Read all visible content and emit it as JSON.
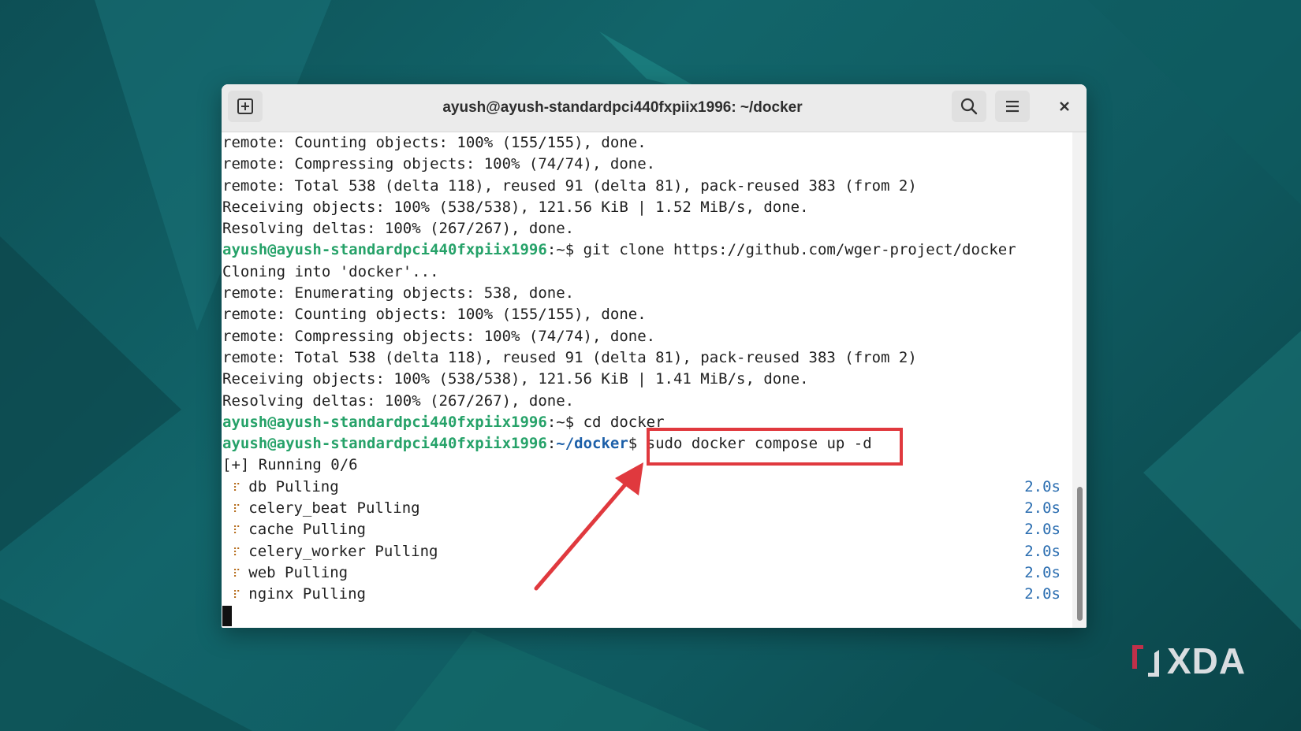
{
  "window": {
    "title": "ayush@ayush-standardpci440fxpiix1996: ~/docker",
    "icons": {
      "new_tab": "new-tab-icon",
      "search": "search-icon",
      "menu": "hamburger-menu-icon",
      "close": "close-icon"
    }
  },
  "terminal": {
    "lines": [
      "remote: Counting objects: 100% (155/155), done.",
      "remote: Compressing objects: 100% (74/74), done.",
      "remote: Total 538 (delta 118), reused 91 (delta 81), pack-reused 383 (from 2)",
      "Receiving objects: 100% (538/538), 121.56 KiB | 1.52 MiB/s, done.",
      "Resolving deltas: 100% (267/267), done."
    ],
    "prompt1": {
      "user": "ayush@ayush-standardpci440fxpiix1996",
      "sep": ":~$ ",
      "cmd": "git clone https://github.com/wger-project/docker"
    },
    "lines2": [
      "Cloning into 'docker'...",
      "remote: Enumerating objects: 538, done.",
      "remote: Counting objects: 100% (155/155), done.",
      "remote: Compressing objects: 100% (74/74), done.",
      "remote: Total 538 (delta 118), reused 91 (delta 81), pack-reused 383 (from 2)",
      "Receiving objects: 100% (538/538), 121.56 KiB | 1.41 MiB/s, done.",
      "Resolving deltas: 100% (267/267), done."
    ],
    "prompt2": {
      "user": "ayush@ayush-standardpci440fxpiix1996",
      "sep": ":~$ ",
      "cmd": "cd docker"
    },
    "prompt3": {
      "user": "ayush@ayush-standardpci440fxpiix1996",
      "sep": ":",
      "path": "~/docker",
      "dollar": "$ ",
      "cmd": "sudo docker compose up -d"
    },
    "running": "[+] Running 0/6",
    "pulls": [
      {
        "label": "db Pulling",
        "time": "2.0s"
      },
      {
        "label": "celery_beat Pulling",
        "time": "2.0s"
      },
      {
        "label": "cache Pulling",
        "time": "2.0s"
      },
      {
        "label": "celery_worker Pulling",
        "time": "2.0s"
      },
      {
        "label": "web Pulling",
        "time": "2.0s"
      },
      {
        "label": "nginx Pulling",
        "time": "2.0s"
      }
    ],
    "spinner_glyph": "⠏"
  },
  "annotation": {
    "color": "#e0393e"
  },
  "watermark": {
    "text": "XDA"
  }
}
